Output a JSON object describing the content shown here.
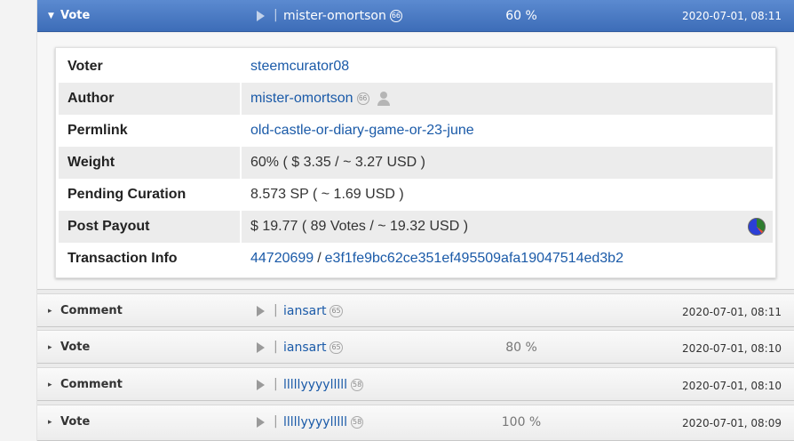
{
  "active_row": {
    "op": "Vote",
    "voter": "mister-omortson",
    "rep": "66",
    "percent": "60 %",
    "timestamp": "2020-07-01, 08:11"
  },
  "details": {
    "voter_label": "Voter",
    "voter_value": "steemcurator08",
    "author_label": "Author",
    "author_value": "mister-omortson",
    "author_rep": "66",
    "permlink_label": "Permlink",
    "permlink_value": "old-castle-or-diary-game-or-23-june",
    "weight_label": "Weight",
    "weight_value": "60% ( $ 3.35 / ~ 3.27 USD )",
    "curation_label": "Pending Curation",
    "curation_value": "8.573 SP ( ~ 1.69 USD )",
    "payout_label": "Post Payout",
    "payout_value": "$ 19.77 ( 89 Votes / ~ 19.32 USD )",
    "tx_label": "Transaction Info",
    "tx_block": "44720699",
    "tx_separator": "/",
    "tx_id": "e3f1fe9bc62ce351ef495509afa19047514ed3b2"
  },
  "rows": [
    {
      "op": "Comment",
      "user": "iansart",
      "rep": "65",
      "percent": "",
      "timestamp": "2020-07-01, 08:11"
    },
    {
      "op": "Vote",
      "user": "iansart",
      "rep": "65",
      "percent": "80 %",
      "timestamp": "2020-07-01, 08:10"
    },
    {
      "op": "Comment",
      "user": "lllllyyyylllll",
      "rep": "58",
      "percent": "",
      "timestamp": "2020-07-01, 08:10"
    },
    {
      "op": "Vote",
      "user": "lllllyyyylllll",
      "rep": "58",
      "percent": "100 %",
      "timestamp": "2020-07-01, 08:09"
    }
  ],
  "icons": {
    "caret_expanded": "caret-down-icon",
    "caret_collapsed": "caret-right-icon",
    "play": "play-icon",
    "person": "person-icon",
    "pie": "pie-chart-icon"
  },
  "colors": {
    "active_header": "#4a7cc4",
    "link": "#1a5aa8"
  }
}
